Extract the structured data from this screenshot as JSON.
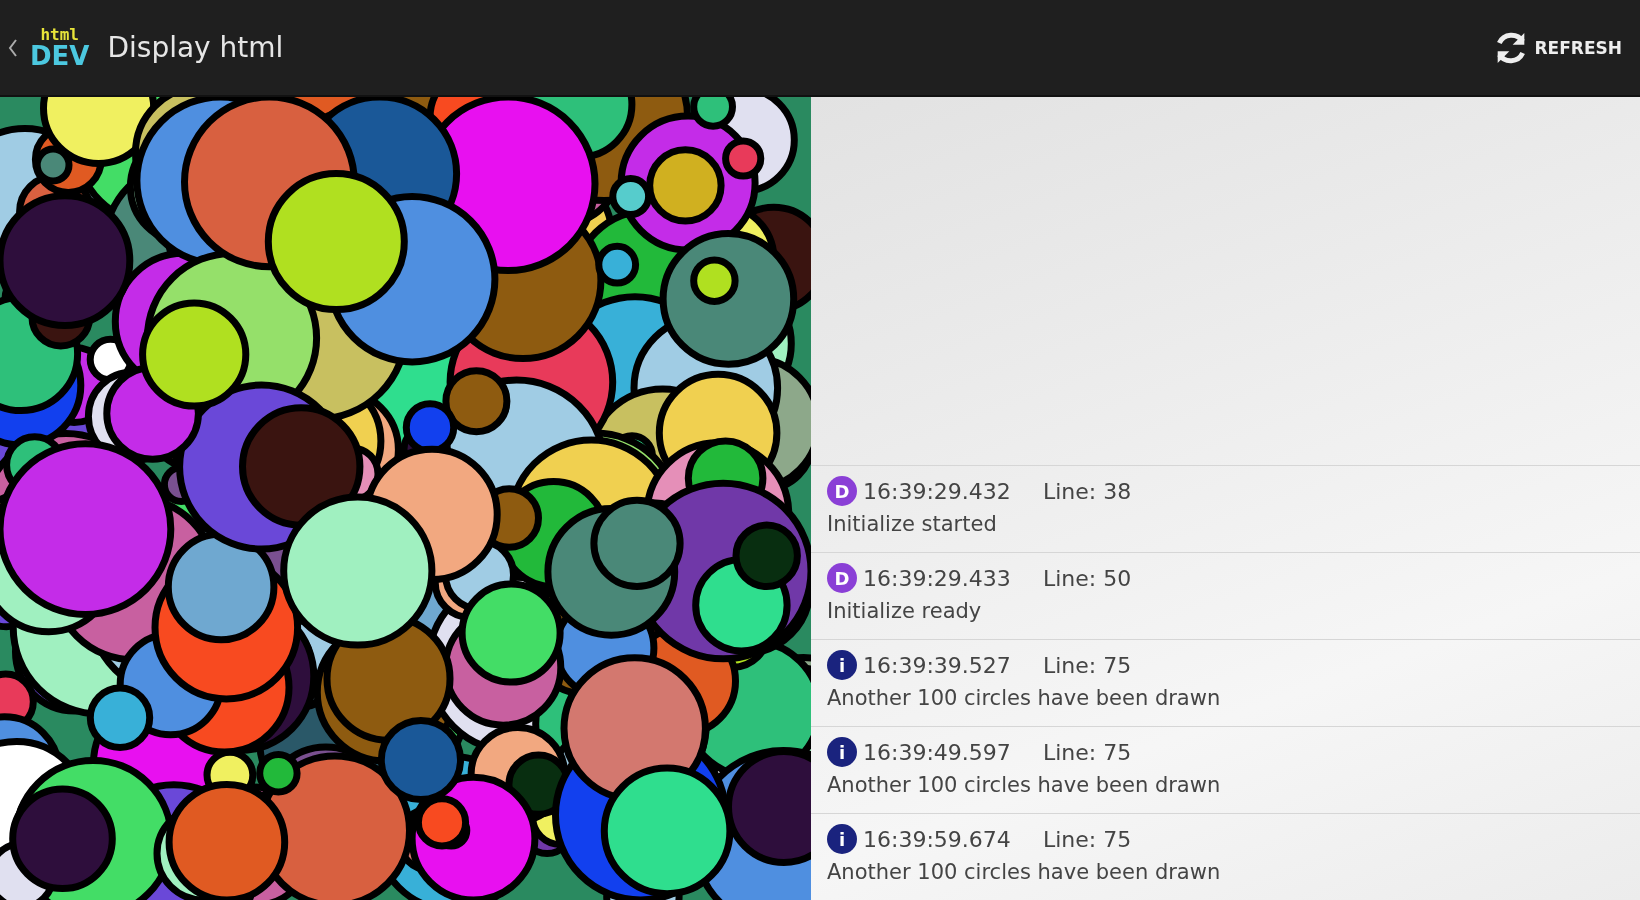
{
  "action_bar": {
    "logo_top": "html",
    "logo_bottom": "DEV",
    "title": "Display html",
    "refresh_label": "REFRESH"
  },
  "log": [
    {
      "kind": "debug",
      "badge": "D",
      "time": "16:39:29.432",
      "line": "Line: 38",
      "message": "Initialize started"
    },
    {
      "kind": "debug",
      "badge": "D",
      "time": "16:39:29.433",
      "line": "Line: 50",
      "message": "Initialize ready"
    },
    {
      "kind": "info",
      "badge": "i",
      "time": "16:39:39.527",
      "line": "Line: 75",
      "message": "Another 100 circles have been drawn"
    },
    {
      "kind": "info",
      "badge": "i",
      "time": "16:39:49.597",
      "line": "Line: 75",
      "message": "Another 100 circles have been drawn"
    },
    {
      "kind": "info",
      "badge": "i",
      "time": "16:39:59.674",
      "line": "Line: 75",
      "message": "Another 100 circles have been drawn"
    }
  ]
}
